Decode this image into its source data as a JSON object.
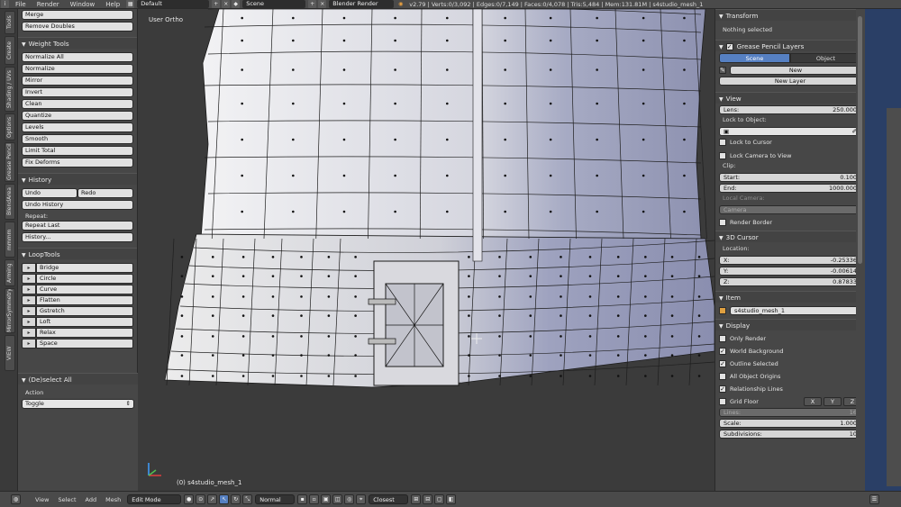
{
  "topbar": {
    "menus": [
      "File",
      "Render",
      "Window",
      "Help"
    ],
    "layout": "Default",
    "scene": "Scene",
    "engine": "Blender Render",
    "stats": "v2.79 | Verts:0/3,092 | Edges:0/7,149 | Faces:0/4,078 | Tris:5,484 | Mem:131.81M | s4studio_mesh_1"
  },
  "vtabs": [
    "Tools",
    "Create",
    "Shading / UVs",
    "Options",
    "Grease Pencil",
    "BlendArea",
    "mmmm tools",
    "Arming",
    "MirrorSymmetry",
    "VIEW HELPER"
  ],
  "toolshelf": {
    "top_buttons": [
      "Merge",
      "Remove Doubles"
    ],
    "weight_tools": {
      "title": "Weight Tools",
      "buttons": [
        "Normalize All",
        "Normalize",
        "Mirror",
        "Invert",
        "Clean",
        "Quantize",
        "Levels",
        "Smooth",
        "Limit Total",
        "Fix Deforms"
      ]
    },
    "history": {
      "title": "History",
      "undo": "Undo",
      "redo": "Redo",
      "undo_history": "Undo History",
      "repeat_label": "Repeat:",
      "repeat_last": "Repeat Last",
      "history_btn": "History..."
    },
    "looptools": {
      "title": "LoopTools",
      "buttons": [
        "Bridge",
        "Circle",
        "Curve",
        "Flatten",
        "Gstretch",
        "Loft",
        "Relax",
        "Space"
      ]
    }
  },
  "operator": {
    "title": "(De)select All",
    "action_label": "Action",
    "action_value": "Toggle"
  },
  "viewport": {
    "view_label": "User Ortho",
    "object_label": "(0) s4studio_mesh_1"
  },
  "properties": {
    "transform": {
      "title": "Transform",
      "status": "Nothing selected"
    },
    "grease_pencil": {
      "title": "Grease Pencil Layers",
      "tab_scene": "Scene",
      "tab_object": "Object",
      "new_btn": "New",
      "new_layer_btn": "New Layer"
    },
    "view": {
      "title": "View",
      "lens_label": "Lens:",
      "lens_value": "250.000",
      "lock_to_object": "Lock to Object:",
      "lock_to_cursor": "Lock to Cursor",
      "lock_camera": "Lock Camera to View",
      "clip": "Clip:",
      "start_label": "Start:",
      "start_value": "0.100",
      "end_label": "End:",
      "end_value": "1000.000",
      "local_camera": "Local Camera:",
      "camera_field": "Camera",
      "render_border": "Render Border"
    },
    "cursor": {
      "title": "3D Cursor",
      "location": "Location:",
      "x_label": "X:",
      "x_value": "-0.25336",
      "y_label": "Y:",
      "y_value": "-0.00614",
      "z_label": "Z:",
      "z_value": "0.87833"
    },
    "item": {
      "title": "Item",
      "name": "s4studio_mesh_1"
    },
    "display": {
      "title": "Display",
      "only_render": "Only Render",
      "world_background": "World Background",
      "outline_selected": "Outline Selected",
      "all_object_origins": "All Object Origins",
      "relationship_lines": "Relationship Lines",
      "grid_floor": "Grid Floor",
      "x": "X",
      "y": "Y",
      "z": "Z",
      "lines_label": "Lines:",
      "lines_value": "16",
      "scale_label": "Scale:",
      "scale_value": "1.000",
      "subdiv_label": "Subdivisions:",
      "subdiv_value": "10"
    }
  },
  "bottombar": {
    "menus": [
      "View",
      "Select",
      "Add",
      "Mesh"
    ],
    "mode": "Edit Mode",
    "pivot": "Normal",
    "snap": "Closest"
  },
  "colors": {
    "accent": "#5680c2",
    "panel": "#474747",
    "viewport": "#3b3b3b"
  }
}
